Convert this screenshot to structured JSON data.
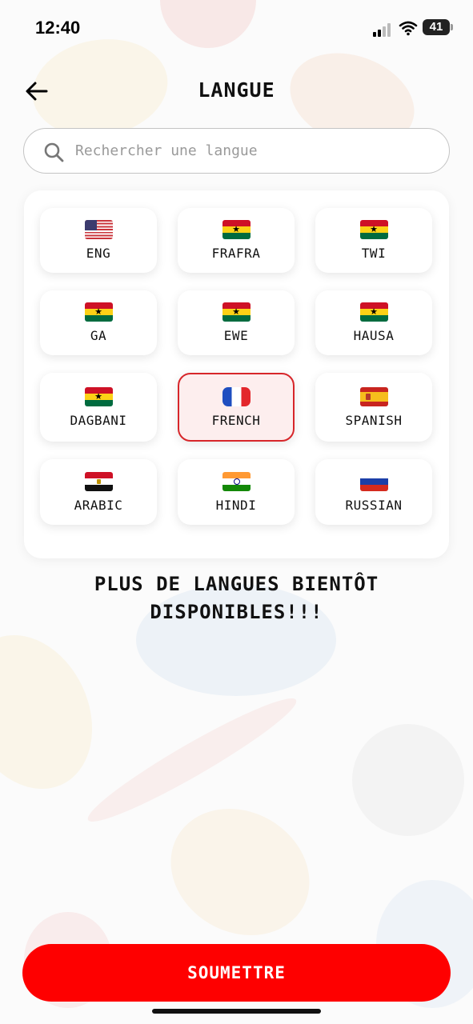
{
  "status_bar": {
    "time": "12:40",
    "battery": "41"
  },
  "header": {
    "title": "LANGUE",
    "back_icon": "arrow-left-icon"
  },
  "search": {
    "placeholder": "Rechercher une langue",
    "value": "",
    "icon": "search-icon"
  },
  "languages": [
    {
      "label": "ENG",
      "flag": "us",
      "selected": false
    },
    {
      "label": "FRAFRA",
      "flag": "ghana",
      "selected": false
    },
    {
      "label": "TWI",
      "flag": "ghana",
      "selected": false
    },
    {
      "label": "GA",
      "flag": "ghana",
      "selected": false
    },
    {
      "label": "EWE",
      "flag": "ghana",
      "selected": false
    },
    {
      "label": "HAUSA",
      "flag": "ghana",
      "selected": false
    },
    {
      "label": "DAGBANI",
      "flag": "ghana",
      "selected": false
    },
    {
      "label": "FRENCH",
      "flag": "france",
      "selected": true
    },
    {
      "label": "SPANISH",
      "flag": "spain",
      "selected": false
    },
    {
      "label": "ARABIC",
      "flag": "egypt",
      "selected": false
    },
    {
      "label": "HINDI",
      "flag": "india",
      "selected": false
    },
    {
      "label": "RUSSIAN",
      "flag": "russia",
      "selected": false
    }
  ],
  "more_languages_text": "PLUS DE LANGUES BIENTÔT\nDISPONIBLES!!!",
  "submit_label": "SOUMETTRE",
  "colors": {
    "accent": "#fe0000",
    "selected_border": "#d7262a",
    "selected_bg": "#fdeeee"
  }
}
